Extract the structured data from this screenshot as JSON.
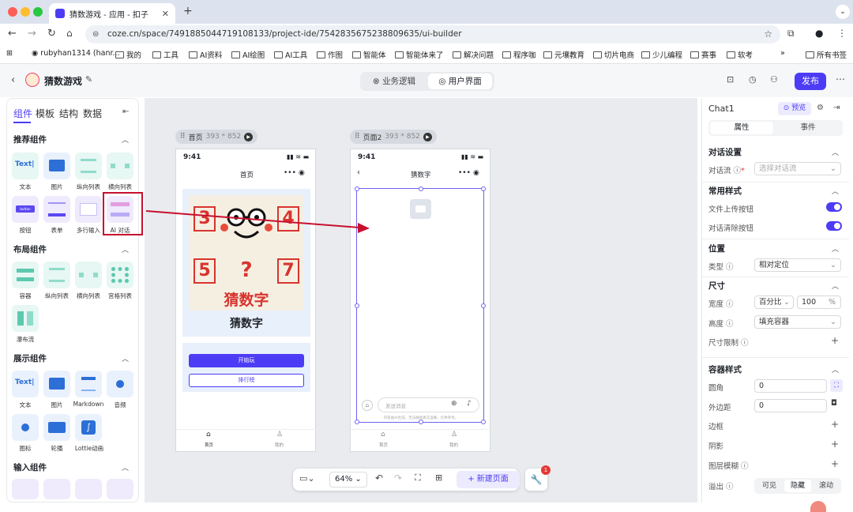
{
  "browser": {
    "tab_title": "猜数游戏 - 应用 - 扣子",
    "url": "coze.cn/space/7491885044719108133/project-ide/7542835675238809635/ui-builder",
    "bookmarks": [
      "rubyhan1314 (hanr...",
      "我的",
      "工具",
      "AI资料",
      "AI绘图",
      "AI工具",
      "作图",
      "智能体",
      "智能体来了",
      "解决问题",
      "程序咖",
      "元壤教育",
      "切片电商",
      "少儿编程",
      "赛事",
      "软考",
      "所有书签"
    ],
    "more": "»"
  },
  "header": {
    "app_name": "猜数游戏",
    "tab_logic": "业务逻辑",
    "tab_ui": "用户界面",
    "publish": "发布"
  },
  "left": {
    "tabs": [
      "组件",
      "模板",
      "结构",
      "数据"
    ],
    "sections": {
      "recommended": "推荐组件",
      "layout": "布局组件",
      "display": "展示组件",
      "input": "输入组件"
    },
    "recommended_items": [
      "文本",
      "图片",
      "纵向列表",
      "横向列表",
      "按钮",
      "表单",
      "多行输入",
      "AI 对话"
    ],
    "layout_items": [
      "容器",
      "纵向列表",
      "横向列表",
      "宫格列表",
      "瀑布流"
    ],
    "display_items": [
      "文本",
      "图片",
      "Markdown",
      "音频",
      "图标",
      "轮播",
      "Lottie动画"
    ],
    "text_icon": "Text|",
    "button_icon": "button"
  },
  "canvas": {
    "frame1": {
      "name": "首页",
      "size": "393 * 852"
    },
    "frame2": {
      "name": "页面2",
      "size": "393 * 852"
    },
    "time": "9:41",
    "page1_title": "首页",
    "page2_title": "猜数字",
    "banner_numbers": [
      "3",
      "4",
      "5",
      "?",
      "7"
    ],
    "banner_text": "猜数字",
    "game_title": "猜数字",
    "start_button": "开始玩",
    "rank_button": "排行榜",
    "nav_home": "首页",
    "nav_mine": "我的",
    "chat_placeholder": "发送消息",
    "chat_disclaimer": "内容由AI生成，无法确保真实准确，仅供参考。"
  },
  "toolbar": {
    "zoom": "64%",
    "new_page": "新建页面",
    "badge": "1"
  },
  "right": {
    "component_name": "Chat1",
    "preview": "预览",
    "tab_props": "属性",
    "tab_events": "事件",
    "dialog_settings": "对话设置",
    "workflow_label": "对话流",
    "workflow_required": "*",
    "workflow_placeholder": "选择对话流",
    "common_style": "常用样式",
    "file_upload": "文件上传按钮",
    "clear_chat": "对话清除按钮",
    "position": "位置",
    "type_label": "类型",
    "type_value": "相对定位",
    "size": "尺寸",
    "width_label": "宽度",
    "width_unit": "百分比",
    "width_value": "100",
    "width_suffix": "%",
    "height_label": "高度",
    "height_value": "填充容器",
    "size_limit": "尺寸限制",
    "container_style": "容器样式",
    "radius_label": "圆角",
    "radius_value": "0",
    "margin_label": "外边距",
    "margin_value": "0",
    "border_label": "边框",
    "shadow_label": "阴影",
    "blur_label": "图层模糊",
    "overflow_label": "溢出",
    "overflow_options": [
      "可见",
      "隐藏",
      "滚动"
    ]
  },
  "colors": {
    "accent": "#4d3cf5",
    "annotation_red": "#c8102e"
  }
}
